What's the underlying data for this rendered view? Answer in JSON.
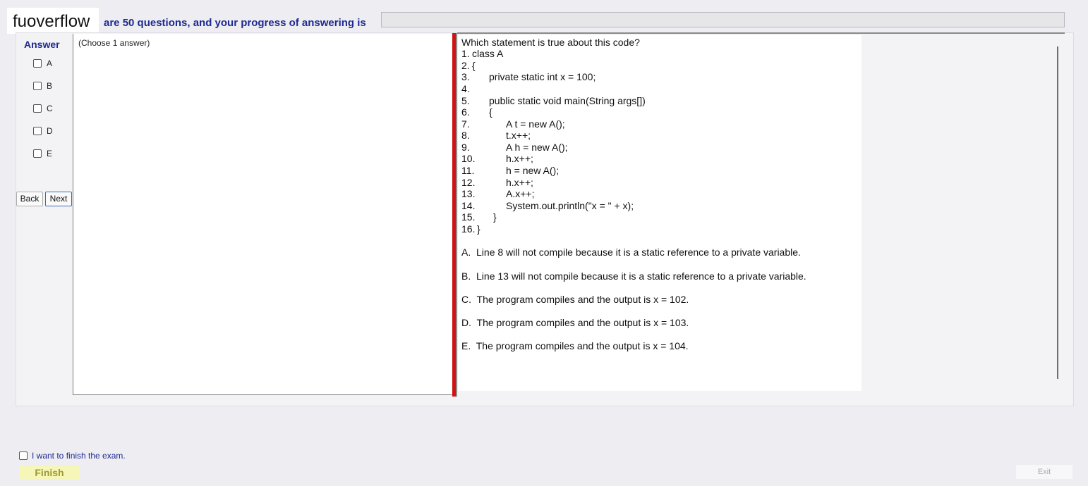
{
  "header": {
    "logo": "fuoverflow",
    "progress_text": "are 50 questions, and your progress of answering is",
    "progress_value": 0
  },
  "answer": {
    "heading": "Answer",
    "options": [
      "A",
      "B",
      "C",
      "D",
      "E"
    ]
  },
  "nav": {
    "back_label": "Back",
    "next_label": "Next"
  },
  "instructions": {
    "choose": "(Choose 1 answer)"
  },
  "question": {
    "prompt": "Which statement is true about this code?",
    "code": [
      {
        "num": "1.",
        "text": "class A"
      },
      {
        "num": "2.",
        "text": "{"
      },
      {
        "num": "3.",
        "text": "private static int x = 100;"
      },
      {
        "num": "4.",
        "text": ""
      },
      {
        "num": "5.",
        "text": "public static void main(String args[])"
      },
      {
        "num": "6.",
        "text": "{"
      },
      {
        "num": "7.",
        "text": "A t = new A();"
      },
      {
        "num": "8.",
        "text": "t.x++;"
      },
      {
        "num": "9.",
        "text": "A h = new A();"
      },
      {
        "num": "10.",
        "text": "h.x++;"
      },
      {
        "num": "11.",
        "text": "h = new A();"
      },
      {
        "num": "12.",
        "text": "h.x++;"
      },
      {
        "num": "13.",
        "text": "A.x++;"
      },
      {
        "num": "14.",
        "text": "System.out.println(\"x = \" + x);"
      },
      {
        "num": "15.",
        "text": "}"
      },
      {
        "num": "16.",
        "text": "}"
      }
    ],
    "choices": [
      "A.  Line 8 will not compile because it is a static reference to a private variable.",
      "B.  Line 13 will not compile because it is a static reference to a private variable.",
      "C.  The program compiles and the output is x = 102.",
      "D.  The program compiles and the output is x = 103.",
      "E.  The program compiles and the output is x = 104."
    ]
  },
  "footer": {
    "finish_checkbox_label": "I want to finish the exam.",
    "finish_label": "Finish",
    "exit_label": "Exit"
  },
  "colors": {
    "accent_blue": "#1e2a8f",
    "divider_red": "#d11212",
    "finish_bg": "#f6f6b8"
  }
}
